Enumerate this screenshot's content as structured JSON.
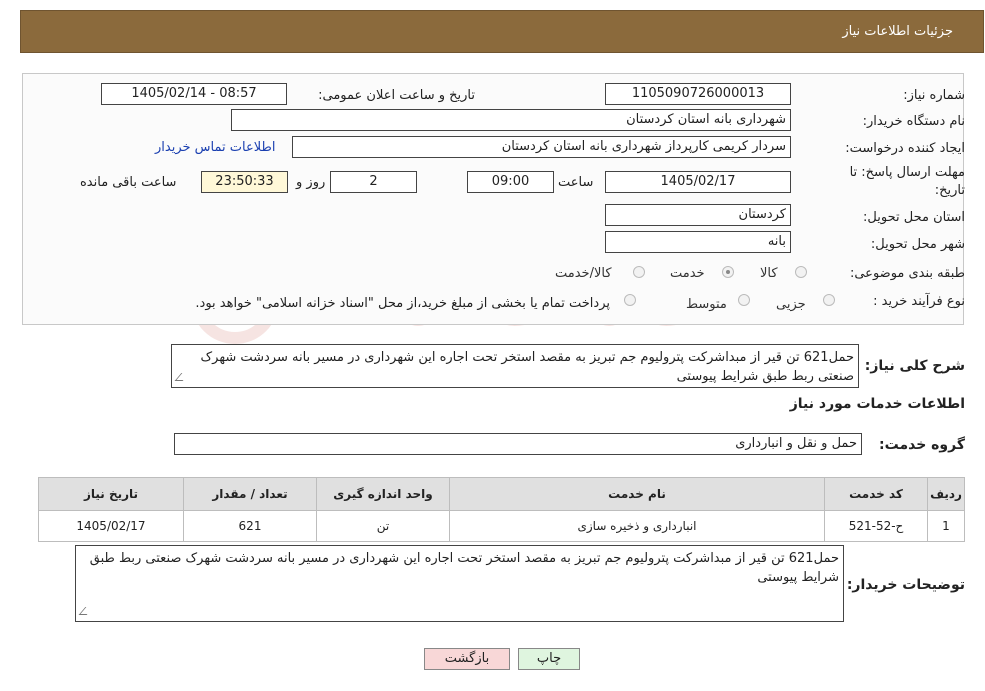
{
  "header": {
    "title": "جزئیات اطلاعات نیاز"
  },
  "form": {
    "need_number_label": "شماره نیاز:",
    "need_number": "1105090726000013",
    "announce_label": "تاریخ و ساعت اعلان عمومی:",
    "announce_value": "1405/02/14 - 08:57",
    "buyer_org_label": "نام دستگاه خریدار:",
    "buyer_org": "شهرداری بانه استان کردستان",
    "creator_label": "ایجاد کننده درخواست:",
    "creator": "سردار کریمی کارپرداز شهرداری بانه استان کردستان",
    "contact_link": "اطلاعات تماس خریدار",
    "deadline_label_1": "مهلت ارسال پاسخ: تا",
    "deadline_label_2": "تاریخ:",
    "deadline_date": "1405/02/17",
    "time_label": "ساعت",
    "deadline_time": "09:00",
    "days_value": "2",
    "days_label": "روز و",
    "remaining_time": "23:50:33",
    "remaining_label": "ساعت باقی مانده",
    "province_label": "استان محل تحویل:",
    "province": "کردستان",
    "city_label": "شهر محل تحویل:",
    "city": "بانه",
    "category_label": "طبقه بندی موضوعی:",
    "category_options": [
      "کالا",
      "خدمت",
      "کالا/خدمت"
    ],
    "category_selected": "خدمت",
    "process_label": "نوع فرآیند خرید :",
    "process_options": [
      "جزیی",
      "متوسط"
    ],
    "process_note": "پرداخت تمام یا بخشی از مبلغ خرید،از محل \"اسناد خزانه اسلامی\" خواهد بود."
  },
  "description": {
    "label": "شرح کلی نیاز:",
    "text": "حمل621 تن  قیر از مبداشرکت پترولیوم جم تبریز به مقصد استخر تحت اجاره این شهرداری در مسیر بانه سردشت شهرک صنعتی ربط طبق شرایط پیوستی"
  },
  "services": {
    "section_title": "اطلاعات خدمات مورد نیاز",
    "group_label": "گروه خدمت:",
    "group_value": "حمل و نقل و انبارداری",
    "table": {
      "headers": [
        "ردیف",
        "کد خدمت",
        "نام خدمت",
        "واحد اندازه گیری",
        "تعداد / مقدار",
        "تاریخ نیاز"
      ],
      "rows": [
        [
          "1",
          "ح-52-521",
          "انبارداری و ذخیره سازی",
          "تن",
          "621",
          "1405/02/17"
        ]
      ]
    }
  },
  "buyer_notes": {
    "label": "توضیحات خریدار:",
    "text": "حمل621 تن  قیر از مبداشرکت پترولیوم جم تبریز به مقصد استخر تحت اجاره این شهرداری در مسیر بانه سردشت شهرک صنعتی ربط طبق شرایط پیوستی"
  },
  "buttons": {
    "print": "چاپ",
    "back": "بازگشت"
  },
  "watermark": {
    "text": "AriaTender.neT"
  },
  "colors": {
    "header_bg": "#8b6a3c",
    "link": "#1a3fb0",
    "back_button_bg": "#f8d7d7",
    "print_button_bg": "#dff5df"
  }
}
